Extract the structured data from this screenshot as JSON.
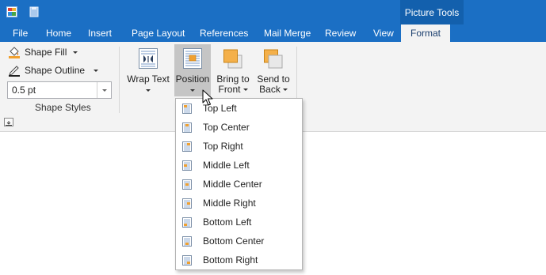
{
  "titlebar": {
    "context_tab_title": "Picture Tools",
    "accent_color": "#1b6fc4",
    "context_color": "#1360ad"
  },
  "tabs": [
    {
      "label": "File"
    },
    {
      "label": "Home"
    },
    {
      "label": "Insert"
    },
    {
      "label": "Page Layout"
    },
    {
      "label": "References"
    },
    {
      "label": "Mail Merge"
    },
    {
      "label": "Review"
    },
    {
      "label": "View"
    },
    {
      "label": "Format",
      "active": true
    }
  ],
  "shape_styles": {
    "shape_fill_label": "Shape Fill",
    "shape_outline_label": "Shape Outline",
    "outline_weight_value": "0.5 pt",
    "group_label": "Shape Styles"
  },
  "arrange": {
    "wrap_text_label": "Wrap Text",
    "position_label": "Position",
    "bring_to_front_line1": "Bring to",
    "bring_to_front_line2": "Front",
    "send_to_back_line1": "Send to",
    "send_to_back_line2": "Back"
  },
  "position_menu": {
    "items": [
      {
        "label": "Top Left",
        "icon": "position-top-left-icon"
      },
      {
        "label": "Top Center",
        "icon": "position-top-center-icon"
      },
      {
        "label": "Top Right",
        "icon": "position-top-right-icon"
      },
      {
        "label": "Middle Left",
        "icon": "position-middle-left-icon"
      },
      {
        "label": "Middle Center",
        "icon": "position-middle-center-icon"
      },
      {
        "label": "Middle Right",
        "icon": "position-middle-right-icon"
      },
      {
        "label": "Bottom Left",
        "icon": "position-bottom-left-icon"
      },
      {
        "label": "Bottom Center",
        "icon": "position-bottom-center-icon"
      },
      {
        "label": "Bottom Right",
        "icon": "position-bottom-right-icon"
      }
    ]
  }
}
